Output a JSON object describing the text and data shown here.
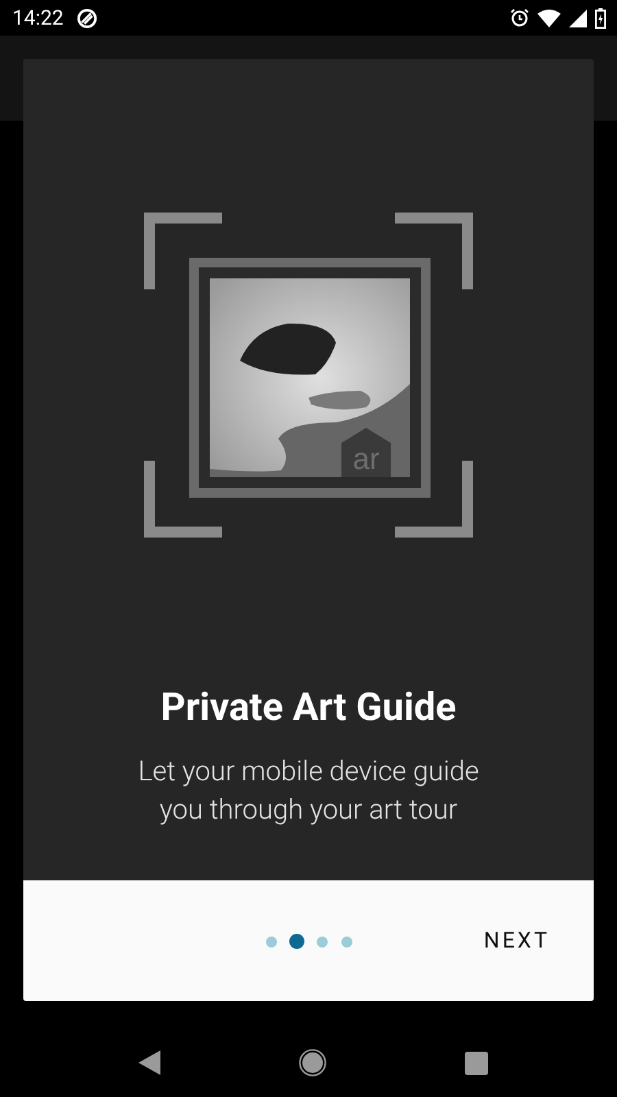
{
  "status_bar": {
    "time": "14:22"
  },
  "dialog": {
    "logo_text": "ar",
    "title": "Private Art Guide",
    "subtitle": "Let your mobile device guide you through your art tour",
    "pages": [
      {
        "selected": false
      },
      {
        "selected": true
      },
      {
        "selected": false
      },
      {
        "selected": false
      }
    ],
    "next_button": "NEXT"
  }
}
